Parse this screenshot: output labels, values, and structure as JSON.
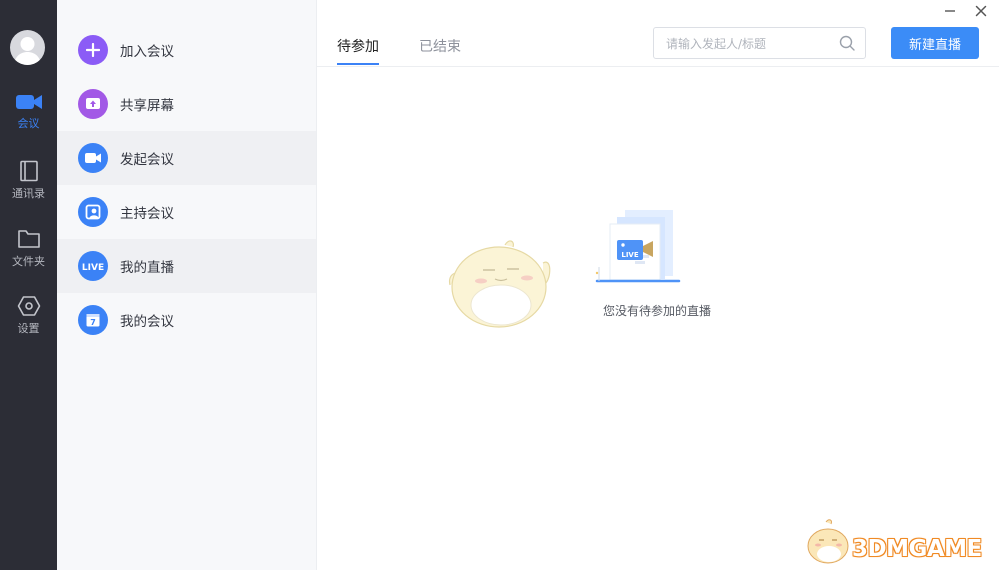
{
  "rail": {
    "items": [
      {
        "label": "会议",
        "icon": "video-camera-icon",
        "active": true
      },
      {
        "label": "通讯录",
        "icon": "contacts-book-icon",
        "active": false
      },
      {
        "label": "文件夹",
        "icon": "folder-icon",
        "active": false
      },
      {
        "label": "设置",
        "icon": "hexagon-settings-icon",
        "active": false
      }
    ]
  },
  "menu": {
    "items": [
      {
        "label": "加入会议",
        "icon": "plus-icon",
        "color": "#8b5cf6"
      },
      {
        "label": "共享屏幕",
        "icon": "share-screen-icon",
        "color": "#a259e6"
      },
      {
        "label": "发起会议",
        "icon": "video-icon",
        "color": "#3b82f6"
      },
      {
        "label": "主持会议",
        "icon": "host-icon",
        "color": "#3b82f6"
      },
      {
        "label": "我的直播",
        "icon": "live-icon",
        "color": "#3b82f6"
      },
      {
        "label": "我的会议",
        "icon": "calendar-icon",
        "color": "#3b82f6"
      }
    ]
  },
  "tabs": [
    {
      "label": "待参加",
      "active": true
    },
    {
      "label": "已结束",
      "active": false
    }
  ],
  "search": {
    "placeholder": "请输入发起人/标题",
    "value": ""
  },
  "new_live_button": {
    "label": "新建直播"
  },
  "empty_state": {
    "text": "您没有待参加的直播",
    "badge": "LIVE"
  },
  "watermark": {
    "text": "3DMGAME"
  },
  "colors": {
    "accent": "#3b82f6",
    "rail_bg": "#2c2d36",
    "menu_bg": "#f7f8fa"
  }
}
